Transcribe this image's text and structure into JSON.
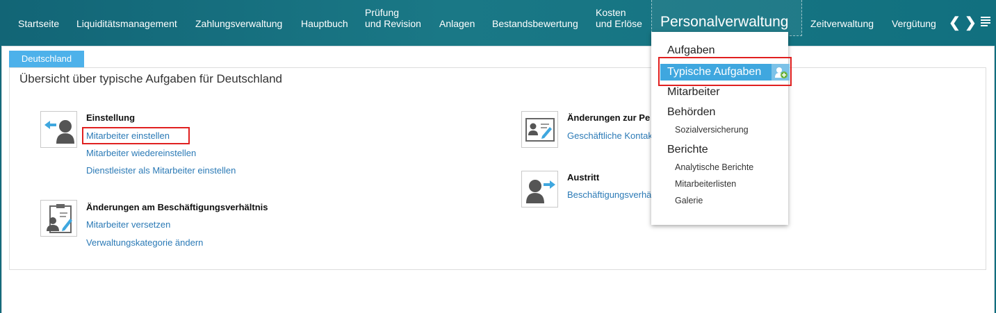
{
  "nav": {
    "items": [
      {
        "label": "Startseite"
      },
      {
        "label": "Liquiditätsmanagement"
      },
      {
        "label": "Zahlungsverwaltung"
      },
      {
        "label": "Hauptbuch"
      },
      {
        "line1": "Prüfung",
        "line2": "und Revision"
      },
      {
        "label": "Anlagen"
      },
      {
        "label": "Bestandsbewertung"
      },
      {
        "line1": "Kosten",
        "line2": "und Erlöse"
      }
    ],
    "active": "Personalverwaltung",
    "after": [
      {
        "label": "Zeitverwaltung"
      },
      {
        "label": "Vergütung"
      }
    ],
    "prev_symbol": "❮",
    "next_symbol": "❯"
  },
  "tab": {
    "label": "Deutschland"
  },
  "page": {
    "title": "Übersicht über typische Aufgaben für Deutschland"
  },
  "groups": {
    "einstellung": {
      "heading": "Einstellung",
      "links": [
        "Mitarbeiter einstellen",
        "Mitarbeiter wiedereinstellen",
        "Dienstleister als Mitarbeiter einstellen"
      ]
    },
    "aenderungen_besch": {
      "heading": "Änderungen am Beschäftigungsverhältnis",
      "links": [
        "Mitarbeiter versetzen",
        "Verwaltungskategorie ändern"
      ]
    },
    "aenderungen_person": {
      "heading": "Änderungen zur Pe",
      "links": [
        "Geschäftliche Kontak"
      ]
    },
    "austritt": {
      "heading": "Austritt",
      "links": [
        "Beschäftigungsverhä"
      ]
    }
  },
  "dropdown": {
    "aufgaben": "Aufgaben",
    "typische": "Typische Aufgaben",
    "mitarbeiter": "Mitarbeiter",
    "behoerden": "Behörden",
    "sozialversicherung": "Sozialversicherung",
    "berichte": "Berichte",
    "analytische": "Analytische Berichte",
    "mitarbeiterlisten": "Mitarbeiterlisten",
    "galerie": "Galerie"
  },
  "colors": {
    "accent": "#3fa7df",
    "link": "#2b7ab6",
    "highlight_frame": "#e02020",
    "nav_bg": "#1a7886"
  },
  "icons": [
    "hire-employee-icon",
    "employment-change-icon",
    "personal-data-change-icon",
    "termination-icon",
    "add-favorite-icon",
    "menu-icon"
  ]
}
